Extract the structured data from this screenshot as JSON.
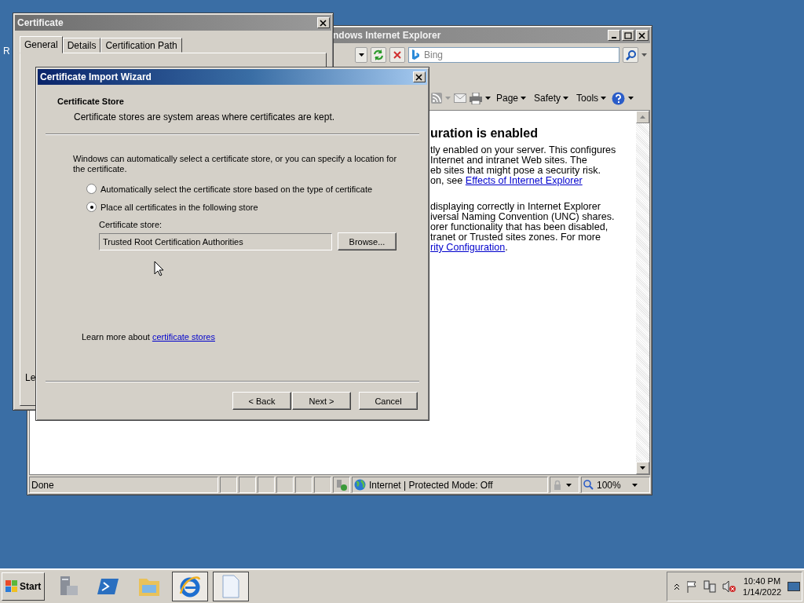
{
  "desktop": {
    "icon_label": "R"
  },
  "ie_window": {
    "title": "ndows Internet Explorer",
    "search": {
      "placeholder": "Bing"
    },
    "command_bar": [
      {
        "label": "Page"
      },
      {
        "label": "Safety"
      },
      {
        "label": "Tools"
      }
    ],
    "content": {
      "heading": "uration is enabled",
      "paragraphs": [
        {
          "lines": [
            "tly enabled on your server. This configures",
            "Internet and intranet Web sites. The",
            "eb sites that might pose a security risk."
          ],
          "last_line": {
            "text": "on, see ",
            "link": "Effects of Internet Explorer"
          }
        },
        {
          "lines": [
            "displaying correctly in Internet Explorer",
            "iversal Naming Convention (UNC) shares.",
            "orer functionality that has been disabled,",
            "tranet or Trusted sites zones. For more"
          ],
          "last_line": {
            "link": "rity Configuration",
            "after": "."
          }
        }
      ]
    },
    "status_bar": {
      "status": "Done",
      "zone": "Internet | Protected Mode: Off",
      "zoom": "100%"
    }
  },
  "certificate_window": {
    "title": "Certificate",
    "tabs": [
      {
        "label": "General",
        "selected": true
      },
      {
        "label": "Details",
        "selected": false
      },
      {
        "label": "Certification Path",
        "selected": false
      }
    ],
    "visible_text": "Le"
  },
  "wizard": {
    "title": "Certificate Import Wizard",
    "header": {
      "title": "Certificate Store",
      "subtitle": "Certificate stores are system areas where certificates are kept."
    },
    "description": "Windows can automatically select a certificate store, or you can specify a location for the certificate.",
    "options": [
      {
        "label": "Automatically select the certificate store based on the type of certificate",
        "selected": false
      },
      {
        "label": "Place all certificates in the following store",
        "selected": true
      }
    ],
    "store_label": "Certificate store:",
    "store_value": "Trusted Root Certification Authorities",
    "browse": "Browse...",
    "learn_more": {
      "text": "Learn more about ",
      "link": "certificate stores"
    },
    "buttons": [
      {
        "label": "< Back"
      },
      {
        "label": "Next >"
      },
      {
        "label": "Cancel"
      }
    ]
  },
  "taskbar": {
    "start": "Start",
    "apps": [
      {
        "kind": "server",
        "selected": false
      },
      {
        "kind": "powershell",
        "selected": false
      },
      {
        "kind": "folder",
        "selected": false
      },
      {
        "kind": "ie",
        "selected": true
      },
      {
        "kind": "document",
        "selected": true
      }
    ],
    "clock": {
      "time": "10:40 PM",
      "date": "1/14/2022"
    }
  }
}
